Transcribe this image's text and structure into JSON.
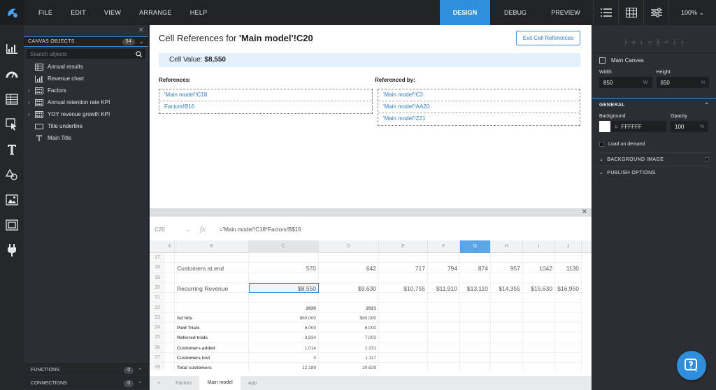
{
  "menu": [
    "FILE",
    "EDIT",
    "VIEW",
    "ARRANGE",
    "HELP"
  ],
  "modes": [
    {
      "label": "DESIGN",
      "active": true
    },
    {
      "label": "DEBUG",
      "active": false
    },
    {
      "label": "PREVIEW",
      "active": false
    }
  ],
  "zoom": "100% ⌄",
  "objects_panel": {
    "header": "CANVAS OBJECTS",
    "count": "54",
    "search_placeholder": "Search objects",
    "items": [
      {
        "label": "Annual results",
        "icon": "table-icon",
        "expandable": false
      },
      {
        "label": "Revenue chart",
        "icon": "chart-icon",
        "expandable": false
      },
      {
        "label": "Factors",
        "icon": "grid-icon",
        "expandable": true
      },
      {
        "label": "Annual retention rate KPI",
        "icon": "grid-icon",
        "expandable": true
      },
      {
        "label": "YOY revenue growth KPI",
        "icon": "grid-icon",
        "expandable": true
      },
      {
        "label": "Title underline",
        "icon": "rectangle-icon",
        "expandable": false
      },
      {
        "label": "Main Title",
        "icon": "text-icon",
        "expandable": false
      }
    ],
    "functions": {
      "label": "FUNCTIONS",
      "count": "0"
    },
    "connections": {
      "label": "CONNECTIONS",
      "count": "0"
    }
  },
  "cell_refs": {
    "title_prefix": "Cell References for ",
    "title_ref": "'Main model'!C20",
    "exit_label": "Exit Cell References",
    "cell_value_label": "Cell Value: ",
    "cell_value": "$8,550",
    "references_heading": "References:",
    "references": [
      "'Main model'!C18",
      "Factors!B16"
    ],
    "referenced_by_heading": "Referenced by:",
    "referenced_by": [
      "'Main model'!C3",
      "'Main model'!AA20",
      "'Main model'!Z21"
    ]
  },
  "formula_bar": {
    "address": "C20",
    "fx": "fx",
    "formula": "='Main model'!C18*Factors!B$16"
  },
  "sheet": {
    "columns": [
      "A",
      "B",
      "C",
      "D",
      "E",
      "F",
      "G",
      "H",
      "I",
      "J"
    ],
    "rows": [
      {
        "n": "17",
        "cells": [
          "",
          "",
          "",
          "",
          "",
          "",
          "",
          "",
          "",
          ""
        ]
      },
      {
        "n": "18",
        "cells": [
          "",
          "Customers at end",
          "570",
          "642",
          "717",
          "794",
          "874",
          "957",
          "1042",
          "1130"
        ]
      },
      {
        "n": "19",
        "cells": [
          "",
          "",
          "",
          "",
          "",
          "",
          "",
          "",
          "",
          ""
        ]
      },
      {
        "n": "20",
        "cells": [
          "",
          "Recurring Revenue",
          "$8,550",
          "$9,630",
          "$10,755",
          "$11,910",
          "$13,110",
          "$14,355",
          "$15,630",
          "$16,950"
        ]
      },
      {
        "n": "21",
        "cells": [
          "",
          "",
          "",
          "",
          "",
          "",
          "",
          "",
          "",
          ""
        ]
      },
      {
        "n": "22",
        "cells": [
          "",
          "",
          "2020",
          "2021",
          "",
          "",
          "",
          "",
          "",
          ""
        ]
      },
      {
        "n": "23",
        "cells": [
          "",
          "Ad hits",
          "$60,000",
          "$60,000",
          "",
          "",
          "",
          "",
          "",
          ""
        ]
      },
      {
        "n": "24",
        "cells": [
          "",
          "Paid Trials",
          "6,000",
          "6,000",
          "",
          "",
          "",
          "",
          "",
          ""
        ]
      },
      {
        "n": "25",
        "cells": [
          "",
          "Referred trials",
          "3,834",
          "7,003",
          "",
          "",
          "",
          "",
          "",
          ""
        ]
      },
      {
        "n": "26",
        "cells": [
          "",
          "Customers added",
          "1,014",
          "1,331",
          "",
          "",
          "",
          "",
          "",
          ""
        ]
      },
      {
        "n": "27",
        "cells": [
          "",
          "Customers lost",
          "0",
          "1,117",
          "",
          "",
          "",
          "",
          "",
          ""
        ]
      },
      {
        "n": "28",
        "cells": [
          "",
          "Total customers",
          "12,189",
          "20,629",
          "",
          "",
          "",
          "",
          "",
          ""
        ]
      }
    ],
    "tabs": [
      "Factors",
      "Main model",
      "App"
    ],
    "active_tab": "Main model"
  },
  "right_panel": {
    "object_name": "Main Canvas",
    "width_label": "Width",
    "width_value": "850",
    "width_unit": "W",
    "height_label": "Height",
    "height_value": "650",
    "height_unit": "H",
    "general": "GENERAL",
    "background_label": "Background",
    "background_hash": "#",
    "background_value": "FFFFFF",
    "opacity_label": "Opacity",
    "opacity_value": "100",
    "opacity_unit": "%",
    "load_on_demand": "Load on demand",
    "background_image": "BACKGROUND IMAGE",
    "publish_options": "PUBLISH OPTIONS"
  },
  "colors": {
    "accent": "#2f8fdd",
    "link": "#2f7cc4",
    "cell_value_bg": "#e4f0fb"
  }
}
